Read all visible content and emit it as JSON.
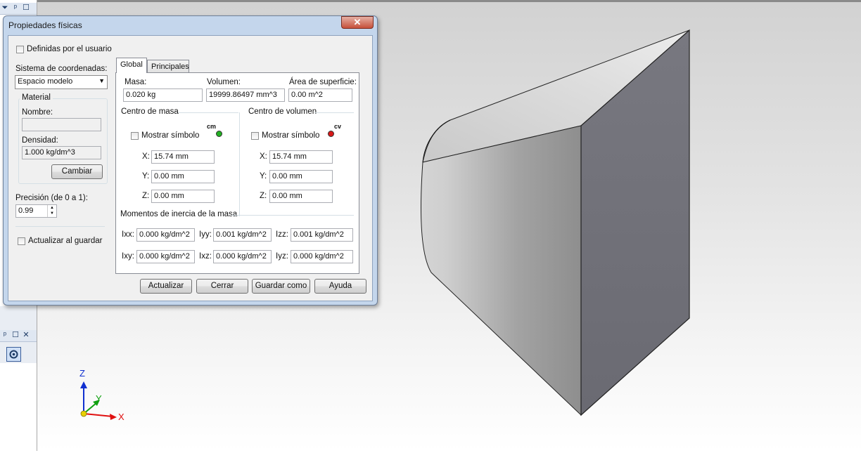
{
  "dialog": {
    "title": "Propiedades físicas",
    "close_label": "✕",
    "user_defined_label": "Definidas por el usuario",
    "coord_system_label": "Sistema de coordenadas:",
    "coord_system_value": "Espacio modelo",
    "material": {
      "group_label": "Material",
      "name_label": "Nombre:",
      "name_value": "",
      "density_label": "Densidad:",
      "density_value": "1.000 kg/dm^3",
      "change_button": "Cambiar"
    },
    "precision_label": "Precisión (de 0 a 1):",
    "precision_value": "0.99",
    "update_on_save_label": "Actualizar al guardar",
    "tabs": [
      {
        "label": "Global",
        "active": true
      },
      {
        "label": "Principales",
        "active": false
      }
    ],
    "global": {
      "mass_label": "Masa:",
      "mass_value": "0.020 kg",
      "volume_label": "Volumen:",
      "volume_value": "19999.86497 mm^3",
      "surface_label": "Área de superficie:",
      "surface_value": "0.00 m^2",
      "center_of_mass": {
        "label": "Centro de masa",
        "show_symbol_label": "Mostrar símbolo",
        "symbol_text": "cm",
        "symbol_color": "#22b022",
        "x_label": "X:",
        "x_value": "15.74 mm",
        "y_label": "Y:",
        "y_value": "0.00 mm",
        "z_label": "Z:",
        "z_value": "0.00 mm"
      },
      "center_of_volume": {
        "label": "Centro de volumen",
        "show_symbol_label": "Mostrar símbolo",
        "symbol_text": "cv",
        "symbol_color": "#d81818",
        "x_label": "X:",
        "x_value": "15.74 mm",
        "y_label": "Y:",
        "y_value": "0.00 mm",
        "z_label": "Z:",
        "z_value": "0.00 mm"
      },
      "inertia": {
        "label": "Momentos de inercia de la masa",
        "ixx_label": "Ixx:",
        "ixx_value": "0.000 kg/dm^2",
        "iyy_label": "Iyy:",
        "iyy_value": "0.001 kg/dm^2",
        "izz_label": "Izz:",
        "izz_value": "0.001 kg/dm^2",
        "ixy_label": "Ixy:",
        "ixy_value": "0.000 kg/dm^2",
        "ixz_label": "Ixz:",
        "ixz_value": "0.000 kg/dm^2",
        "iyz_label": "Iyz:",
        "iyz_value": "0.000 kg/dm^2"
      }
    },
    "buttons": {
      "update": "Actualizar",
      "close": "Cerrar",
      "save_as": "Guardar como",
      "help": "Ayuda"
    }
  },
  "left_panel": {
    "top_buttons": [
      "⏷",
      "ᵖ",
      "☐"
    ],
    "bottom_buttons": [
      "ᵖ",
      "☐",
      "✕"
    ]
  },
  "viewport": {
    "axes": {
      "x": "X",
      "y": "Y",
      "z": "Z"
    },
    "colors": {
      "x": "#e01010",
      "y": "#10a010",
      "z": "#1030d0",
      "origin": "#e8d000"
    }
  }
}
